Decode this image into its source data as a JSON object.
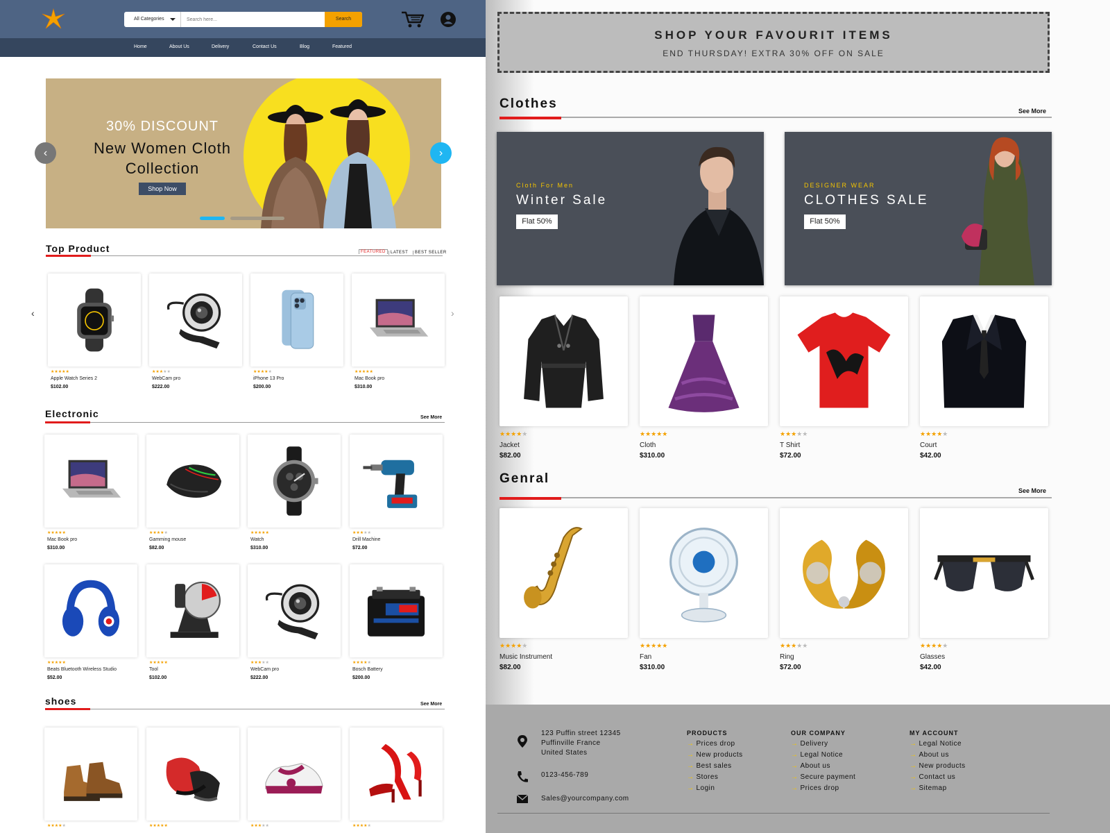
{
  "header": {
    "category_label": "All Categories",
    "search_placeholder": "Search here...",
    "search_button": "Search"
  },
  "nav": [
    "Home",
    "About Us",
    "Delivery",
    "Contact Us",
    "Blog",
    "Featured"
  ],
  "hero": {
    "discount": "30% DISCOUNT",
    "title": "New Women Cloth Collection",
    "cta": "Shop Now"
  },
  "top_product": {
    "title": "Top Product",
    "tabs": [
      "FEATURED",
      "LATEST",
      "BEST SELLER"
    ],
    "items": [
      {
        "name": "Apple Watch Series 2",
        "price": "$102.00",
        "rating": 5,
        "icon": "watch-icon"
      },
      {
        "name": "WebCam pro",
        "price": "$222.00",
        "rating": 3,
        "icon": "webcam-icon"
      },
      {
        "name": "iPhone 13 Pro",
        "price": "$200.00",
        "rating": 4,
        "icon": "phone-icon"
      },
      {
        "name": "Mac Book pro",
        "price": "$310.00",
        "rating": 5,
        "icon": "laptop-icon"
      }
    ]
  },
  "electronic": {
    "title": "Electronic",
    "see_more": "See More",
    "items": [
      {
        "name": "Mac Book pro",
        "price": "$310.00",
        "rating": 5,
        "icon": "laptop-icon"
      },
      {
        "name": "Gamming mouse",
        "price": "$82.00",
        "rating": 4,
        "icon": "mouse-icon"
      },
      {
        "name": "Watch",
        "price": "$310.00",
        "rating": 5,
        "icon": "wristwatch-icon"
      },
      {
        "name": "Drill Machine",
        "price": "$72.00",
        "rating": 3,
        "icon": "drill-icon"
      },
      {
        "name": "Beats Bluetooth Wireless Studio",
        "price": "$52.00",
        "rating": 5,
        "icon": "headphones-icon"
      },
      {
        "name": "Tool",
        "price": "$102.00",
        "rating": 5,
        "icon": "saw-icon"
      },
      {
        "name": "WebCam pro",
        "price": "$222.00",
        "rating": 3,
        "icon": "webcam-icon"
      },
      {
        "name": "Bosch Battery",
        "price": "$200.00",
        "rating": 4,
        "icon": "battery-icon"
      }
    ]
  },
  "shoes": {
    "title": "shoes",
    "see_more": "See More",
    "items": [
      {
        "rating": 4,
        "icon": "boot-icon"
      },
      {
        "rating": 5,
        "icon": "sneaker-icon"
      },
      {
        "rating": 3,
        "icon": "sport-shoe-icon"
      },
      {
        "rating": 4,
        "icon": "heel-icon"
      }
    ]
  },
  "promo": {
    "line1": "SHOP YOUR FAVOURIT ITEMS",
    "line2": "END THURSDAY! EXTRA 30% OFF ON SALE"
  },
  "clothes": {
    "title": "Clothes",
    "see_more": "See More",
    "banners": [
      {
        "kicker": "Cloth For Men",
        "headline": "Winter Sale",
        "badge": "Flat 50%"
      },
      {
        "kicker": "DESIGNER WEAR",
        "headline": "CLOTHES SALE",
        "badge": "Flat 50%"
      }
    ],
    "items": [
      {
        "name": "Jacket",
        "price": "$82.00",
        "rating": 4,
        "icon": "coat-icon"
      },
      {
        "name": "Cloth",
        "price": "$310.00",
        "rating": 5,
        "icon": "gown-icon"
      },
      {
        "name": "T Shirt",
        "price": "$72.00",
        "rating": 3,
        "icon": "tshirt-icon"
      },
      {
        "name": "Court",
        "price": "$42.00",
        "rating": 4,
        "icon": "suit-icon"
      }
    ]
  },
  "general": {
    "title": "Genral",
    "see_more": "See More",
    "items": [
      {
        "name": "Music Instrument",
        "price": "$82.00",
        "rating": 4,
        "icon": "saxophone-icon"
      },
      {
        "name": "Fan",
        "price": "$310.00",
        "rating": 5,
        "icon": "fan-icon"
      },
      {
        "name": "Ring",
        "price": "$72.00",
        "rating": 3,
        "icon": "ring-icon"
      },
      {
        "name": "Glasses",
        "price": "$42.00",
        "rating": 4,
        "icon": "sunglasses-icon"
      }
    ]
  },
  "footer": {
    "address": [
      "123 Puffin street 12345",
      "Puffinville France",
      "United States"
    ],
    "phone": "0123-456-789",
    "email": "Sales@yourcompany.com",
    "columns": [
      {
        "title": "PRODUCTS",
        "items": [
          "Prices drop",
          "New products",
          "Best sales",
          "Stores",
          "Login"
        ]
      },
      {
        "title": "OUR COMPANY",
        "items": [
          "Delivery",
          "Legal Notice",
          "About us",
          "Secure payment",
          "Prices drop"
        ]
      },
      {
        "title": "MY ACCOUNT",
        "items": [
          "Legal Notice",
          "About us",
          "New products",
          "Contact us",
          "Sitemap"
        ]
      }
    ]
  },
  "colors": {
    "header_bg": "#4e6484",
    "nav_bg": "#35465e",
    "accent_red": "#e11c1c",
    "star": "#f4a100",
    "search_button": "#f4a100",
    "banner_bg": "#4a4f58",
    "footer_bg": "#a9a9a9"
  }
}
